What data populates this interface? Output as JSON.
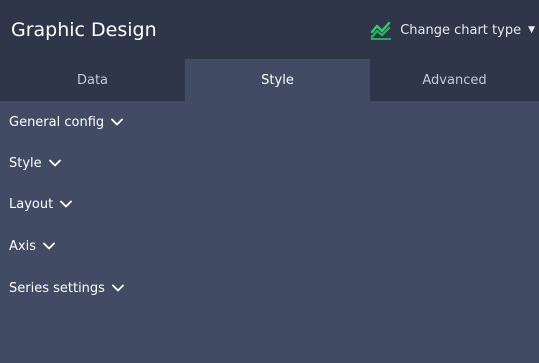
{
  "header": {
    "title": "Graphic Design",
    "change_chart_type_label": "Change chart type",
    "chart_icon": "line-chart-icon",
    "accent_color": "#2ecc71"
  },
  "tabs": [
    {
      "label": "Data",
      "active": false
    },
    {
      "label": "Style",
      "active": true
    },
    {
      "label": "Advanced",
      "active": false
    }
  ],
  "sections": [
    {
      "label": "General config",
      "expanded": false
    },
    {
      "label": "Style",
      "expanded": false
    },
    {
      "label": "Layout",
      "expanded": false
    },
    {
      "label": "Axis",
      "expanded": false
    },
    {
      "label": "Series settings",
      "expanded": false
    }
  ],
  "colors": {
    "header_bg": "#2f364a",
    "panel_bg": "#414b63",
    "text": "#ffffff"
  }
}
